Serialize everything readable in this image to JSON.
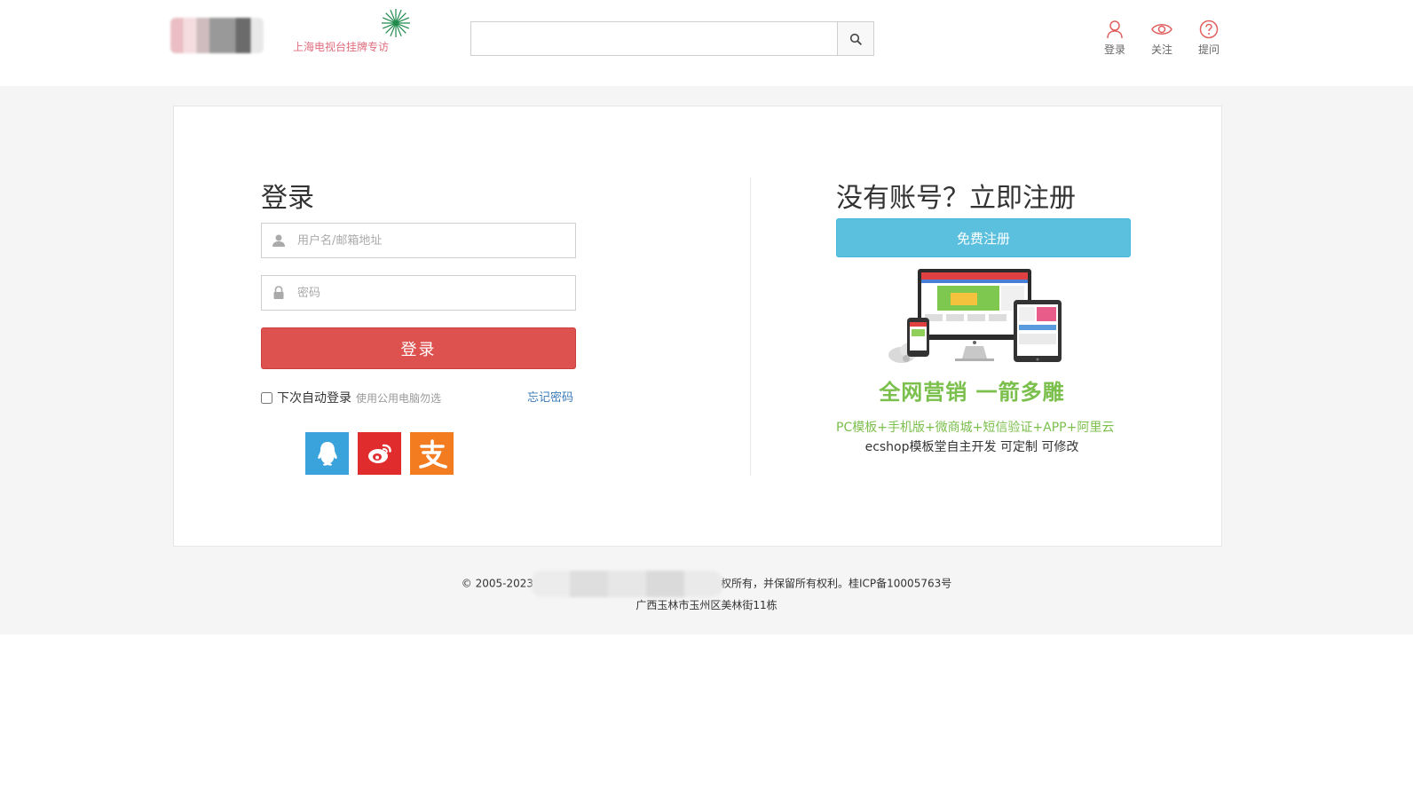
{
  "header": {
    "logo_slogan": "上海电视台挂牌专访",
    "search": {
      "value": "",
      "placeholder": ""
    },
    "links": {
      "login": "登录",
      "follow": "关注",
      "ask": "提问"
    }
  },
  "login": {
    "title": "登录",
    "username_placeholder": "用户名/邮箱地址",
    "password_placeholder": "密码",
    "submit_label": "登录",
    "remember_label": "下次自动登录",
    "remember_hint": "使用公用电脑勿选",
    "remember_checked": false,
    "forgot_label": "忘记密码",
    "social": [
      "qq-icon",
      "weibo-icon",
      "alipay-icon"
    ]
  },
  "register": {
    "title": "没有账号？立即注册",
    "button_label": "免费注册",
    "slogan": "全网营销 一箭多雕",
    "features": "PC模板+手机版+微商城+短信验证+APP+阿里云",
    "description": "ecshop模板堂自主开发 可定制 可修改"
  },
  "footer": {
    "copyright_prefix": "© 2005-2023",
    "copyright_suffix": "权所有，并保留所有权利。桂ICP备10005763号",
    "address": "广西玉林市玉州区美林街11栋"
  },
  "colors": {
    "login_button": "#dd524f",
    "register_button": "#5bc0de",
    "promo_green": "#7bbf4c",
    "link_blue": "#3a7ab8",
    "qq": "#3aa3dc",
    "weibo": "#e02c2c",
    "alipay": "#f47c20",
    "header_icon": "#e0605f"
  }
}
